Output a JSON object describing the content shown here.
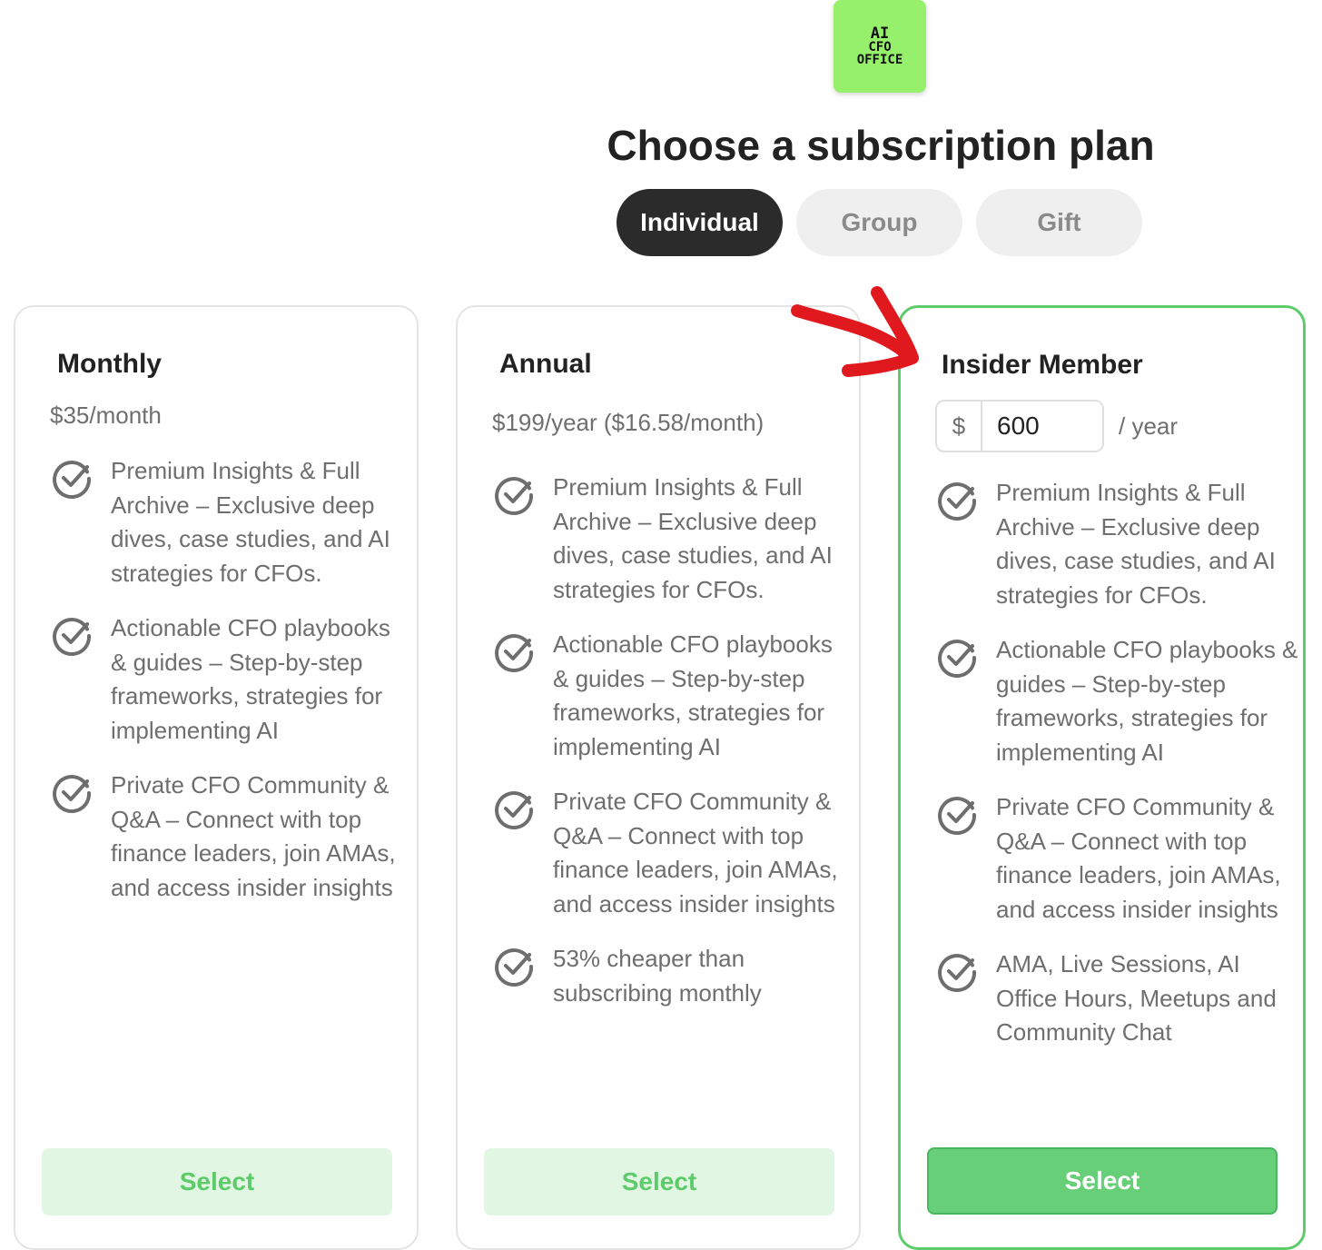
{
  "logo": {
    "line1": "AI",
    "line2": "CFO",
    "line3": "OFFICE"
  },
  "title": "Choose a subscription plan",
  "tabs": [
    {
      "label": "Individual",
      "active": true
    },
    {
      "label": "Group",
      "active": false
    },
    {
      "label": "Gift",
      "active": false
    }
  ],
  "plans": [
    {
      "name": "Monthly",
      "price": "$35/month",
      "features": [
        "Premium Insights & Full Archive – Exclusive deep dives, case studies, and AI strategies for CFOs.",
        "Actionable CFO playbooks & guides – Step-by-step frameworks, strategies for implementing AI",
        "Private CFO Community & Q&A – Connect with top finance leaders, join AMAs, and access insider insights"
      ],
      "select_label": "Select"
    },
    {
      "name": "Annual",
      "price": "$199/year ($16.58/month)",
      "features": [
        "Premium Insights & Full Archive – Exclusive deep dives, case studies, and AI strategies for CFOs.",
        "Actionable CFO playbooks & guides – Step-by-step frameworks, strategies for implementing AI",
        "Private CFO Community & Q&A – Connect with top finance leaders, join AMAs, and access insider insights",
        "53% cheaper than subscribing monthly"
      ],
      "select_label": "Select"
    },
    {
      "name": "Insider Member",
      "currency": "$",
      "amount": "600",
      "period": "/ year",
      "features": [
        "Premium Insights & Full Archive – Exclusive deep dives, case studies, and AI strategies for CFOs.",
        "Actionable CFO playbooks & guides – Step-by-step frameworks, strategies for implementing AI",
        "Private CFO Community & Q&A – Connect with top finance leaders, join AMAs, and access insider insights",
        "AMA, Live Sessions, AI Office Hours, Meetups and Community Chat"
      ],
      "select_label": "Select"
    }
  ],
  "colors": {
    "accent_green": "#66cf78",
    "light_green": "#e2f6e4",
    "logo_green": "#97f06b",
    "annotation_red": "#e0191f",
    "active_tab": "#2b2b2b"
  },
  "icons": {
    "feature": "check-circle-icon",
    "annotation": "red-arrow-annotation"
  }
}
